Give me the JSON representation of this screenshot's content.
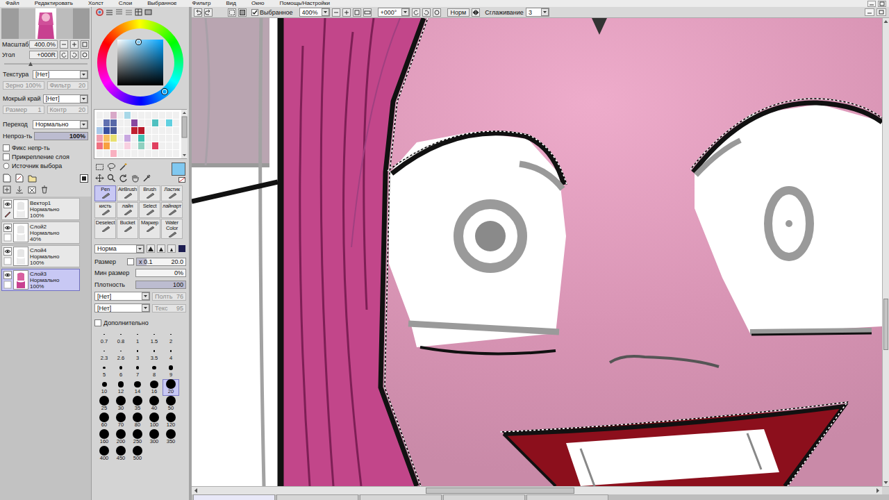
{
  "menu": [
    "Файл",
    "Редактировать",
    "Холст",
    "Слои",
    "Выбранное",
    "Фильтр",
    "Вид",
    "Окно",
    "Помощь/Настройки"
  ],
  "navigator": {
    "zoom_label": "Масштаб",
    "zoom": "400.0%",
    "angle_label": "Угол",
    "angle": "+000R"
  },
  "layer_panel": {
    "texture": {
      "label": "Текстура",
      "value": "[Нет]"
    },
    "texture_params": [
      {
        "label": "Зерно",
        "value": "100%",
        "disabled": true
      },
      {
        "label": "Фильтр",
        "value": "20",
        "disabled": true
      }
    ],
    "wet_edge": {
      "label": "Мокрый край",
      "value": "[Нет]"
    },
    "wet_params": [
      {
        "label": "Размер",
        "value": "1",
        "disabled": true
      },
      {
        "label": "Контр",
        "value": "20",
        "disabled": true
      }
    ],
    "blend": {
      "label": "Переход",
      "value": "Нормально"
    },
    "opacity": {
      "label": "Непроз-ть",
      "value": "100%",
      "level": 1
    },
    "options": [
      {
        "label": "Фикс непр-ть",
        "checked": false,
        "kind": "checkbox"
      },
      {
        "label": "Прикрепление слоя",
        "checked": false,
        "kind": "checkbox"
      },
      {
        "label": "Источник выбора",
        "checked": false,
        "kind": "radio"
      }
    ]
  },
  "layers": [
    {
      "name": "Вектор1",
      "mode": "Нормально",
      "opacity": "100%",
      "visible": true,
      "selected": false,
      "kind": "vector"
    },
    {
      "name": "Слой2",
      "mode": "Нормально",
      "opacity": "40%",
      "visible": true,
      "selected": false,
      "kind": "raster"
    },
    {
      "name": "Слой4",
      "mode": "Нормально",
      "opacity": "100%",
      "visible": true,
      "selected": false,
      "kind": "raster"
    },
    {
      "name": "Слой3",
      "mode": "Нормально",
      "opacity": "100%",
      "visible": true,
      "selected": true,
      "kind": "raster"
    }
  ],
  "color": {
    "current": "#80c8f0"
  },
  "palette": [
    {
      "color": "#f0f0f0"
    },
    {
      "color": "#f0f0f0"
    },
    {
      "color": "#d8a8c8"
    },
    {
      "color": "#f0f0f0"
    },
    {
      "color": "#a8d8e8"
    },
    {
      "color": "#f0f0f0"
    },
    {
      "color": "#f0f0f0"
    },
    {
      "color": "#f0f0f0"
    },
    {
      "color": "#f0f0f0"
    },
    {
      "color": "#f0f0f0"
    },
    {
      "color": "#f0f0f0"
    },
    {
      "color": "#f0f0f0"
    },
    {
      "color": "#f0f0f0"
    },
    {
      "color": "#6070b0"
    },
    {
      "color": "#5868a8"
    },
    {
      "color": "#f0f0f0"
    },
    {
      "color": "#f0f0f0"
    },
    {
      "color": "#8848a0"
    },
    {
      "color": "#f0f0f0"
    },
    {
      "color": "#f0f0f0"
    },
    {
      "color": "#50c0c0"
    },
    {
      "color": "#f0f0f0"
    },
    {
      "color": "#60d0e0"
    },
    {
      "color": "#f0f0f0"
    },
    {
      "color": "#a8c8e8"
    },
    {
      "color": "#3850a0"
    },
    {
      "color": "#485898"
    },
    {
      "color": "#f0f0f0"
    },
    {
      "color": "#f0f0f0"
    },
    {
      "color": "#c02030"
    },
    {
      "color": "#b81828"
    },
    {
      "color": "#f0f0f0"
    },
    {
      "color": "#f0f0f0"
    },
    {
      "color": "#f0f0f0"
    },
    {
      "color": "#f0f0f0"
    },
    {
      "color": "#f0f0f0"
    },
    {
      "color": "#f0a0b0"
    },
    {
      "color": "#f8c060"
    },
    {
      "color": "#e8e070"
    },
    {
      "color": "#f0f0f0"
    },
    {
      "color": "#c8a8e0"
    },
    {
      "color": "#f0f0f0"
    },
    {
      "color": "#40c0b0"
    },
    {
      "color": "#f0f0f0"
    },
    {
      "color": "#f0f0f0"
    },
    {
      "color": "#f0f0f0"
    },
    {
      "color": "#f0f0f0"
    },
    {
      "color": "#f0f0f0"
    },
    {
      "color": "#f07080"
    },
    {
      "color": "#f8a040"
    },
    {
      "color": "#f0f0f0"
    },
    {
      "color": "#f0f0f0"
    },
    {
      "color": "#f8d0e0"
    },
    {
      "color": "#f0f0f0"
    },
    {
      "color": "#90d0c0"
    },
    {
      "color": "#f0f0f0"
    },
    {
      "color": "#e04060"
    },
    {
      "color": "#f0f0f0"
    },
    {
      "color": "#f0f0f0"
    },
    {
      "color": "#f0f0f0"
    },
    {
      "color": "#f0f0f0"
    },
    {
      "color": "#f0f0f0"
    },
    {
      "color": "#f8b0c0"
    },
    {
      "color": "#f0f0f0"
    },
    {
      "color": "#f0f0f0"
    },
    {
      "color": "#f0f0f0"
    },
    {
      "color": "#f0f0f0"
    },
    {
      "color": "#f0f0f0"
    },
    {
      "color": "#f0f0f0"
    },
    {
      "color": "#f0f0f0"
    },
    {
      "color": "#f0f0f0"
    },
    {
      "color": "#f0f0f0"
    }
  ],
  "tools": [
    {
      "label": "Pen",
      "selected": true
    },
    {
      "label": "AirBrush",
      "selected": false
    },
    {
      "label": "Brush",
      "selected": false
    },
    {
      "label": "Ластик",
      "selected": false
    },
    {
      "label": "кисть",
      "selected": false
    },
    {
      "label": "лайн",
      "selected": false
    },
    {
      "label": "Select",
      "selected": false
    },
    {
      "label": "лайнарт",
      "selected": false
    },
    {
      "label": "Deselect",
      "selected": false
    },
    {
      "label": "Bucket",
      "selected": false
    },
    {
      "label": "Маркер",
      "selected": false
    },
    {
      "label": "Water Color",
      "selected": false
    }
  ],
  "brush": {
    "mode": "Норма",
    "tip_shapes": [
      {
        "selected": false
      },
      {
        "selected": false
      },
      {
        "selected": false
      },
      {
        "selected": true
      }
    ],
    "size": {
      "label": "Размер",
      "checked": false,
      "multiplier": "x 0.1",
      "value": "20.0",
      "level": 0.2
    },
    "min_size": {
      "label": "Мин размер",
      "value": "0%",
      "level": 0
    },
    "density": {
      "label": "Плотность",
      "value": "100",
      "level": 1
    },
    "shape": {
      "value": "[Нет]",
      "param_label": "Полть",
      "param": "76",
      "disabled": true
    },
    "texture": {
      "value": "[Нет]",
      "param_label": "Текс",
      "param": "95",
      "disabled": true
    },
    "advanced": {
      "label": "Дополнительно",
      "checked": false
    }
  },
  "brush_sizes": [
    {
      "label": "0.7",
      "selected": false
    },
    {
      "label": "0.8",
      "selected": false
    },
    {
      "label": "1",
      "selected": false
    },
    {
      "label": "1.5",
      "selected": false
    },
    {
      "label": "2",
      "selected": false
    },
    {
      "label": "2.3",
      "selected": false
    },
    {
      "label": "2.6",
      "selected": false
    },
    {
      "label": "3",
      "selected": false
    },
    {
      "label": "3.5",
      "selected": false
    },
    {
      "label": "4",
      "selected": false
    },
    {
      "label": "5",
      "selected": false
    },
    {
      "label": "6",
      "selected": false
    },
    {
      "label": "7",
      "selected": false
    },
    {
      "label": "8",
      "selected": false
    },
    {
      "label": "9",
      "selected": false
    },
    {
      "label": "10",
      "selected": false
    },
    {
      "label": "12",
      "selected": false
    },
    {
      "label": "14",
      "selected": false
    },
    {
      "label": "16",
      "selected": false
    },
    {
      "label": "20",
      "selected": true
    },
    {
      "label": "25",
      "selected": false
    },
    {
      "label": "30",
      "selected": false
    },
    {
      "label": "35",
      "selected": false
    },
    {
      "label": "40",
      "selected": false
    },
    {
      "label": "50",
      "selected": false
    },
    {
      "label": "60",
      "selected": false
    },
    {
      "label": "70",
      "selected": false
    },
    {
      "label": "80",
      "selected": false
    },
    {
      "label": "100",
      "selected": false
    },
    {
      "label": "120",
      "selected": false
    },
    {
      "label": "160",
      "selected": false
    },
    {
      "label": "200",
      "selected": false
    },
    {
      "label": "250",
      "selected": false
    },
    {
      "label": "300",
      "selected": false
    },
    {
      "label": "350",
      "selected": false
    },
    {
      "label": "400",
      "selected": false
    },
    {
      "label": "450",
      "selected": false
    },
    {
      "label": "500",
      "selected": false
    }
  ],
  "canvas_toolbar": {
    "selection": {
      "label": "Выбранное",
      "checked": true
    },
    "zoom": "400%",
    "angle": "+000°",
    "mode": "Норм",
    "stabilizer_label": "Сглаживание",
    "stabilizer": "3"
  },
  "scrollbars": {
    "vertical": {
      "level": 0.68
    },
    "horizontal": {
      "level": 0.43
    }
  }
}
